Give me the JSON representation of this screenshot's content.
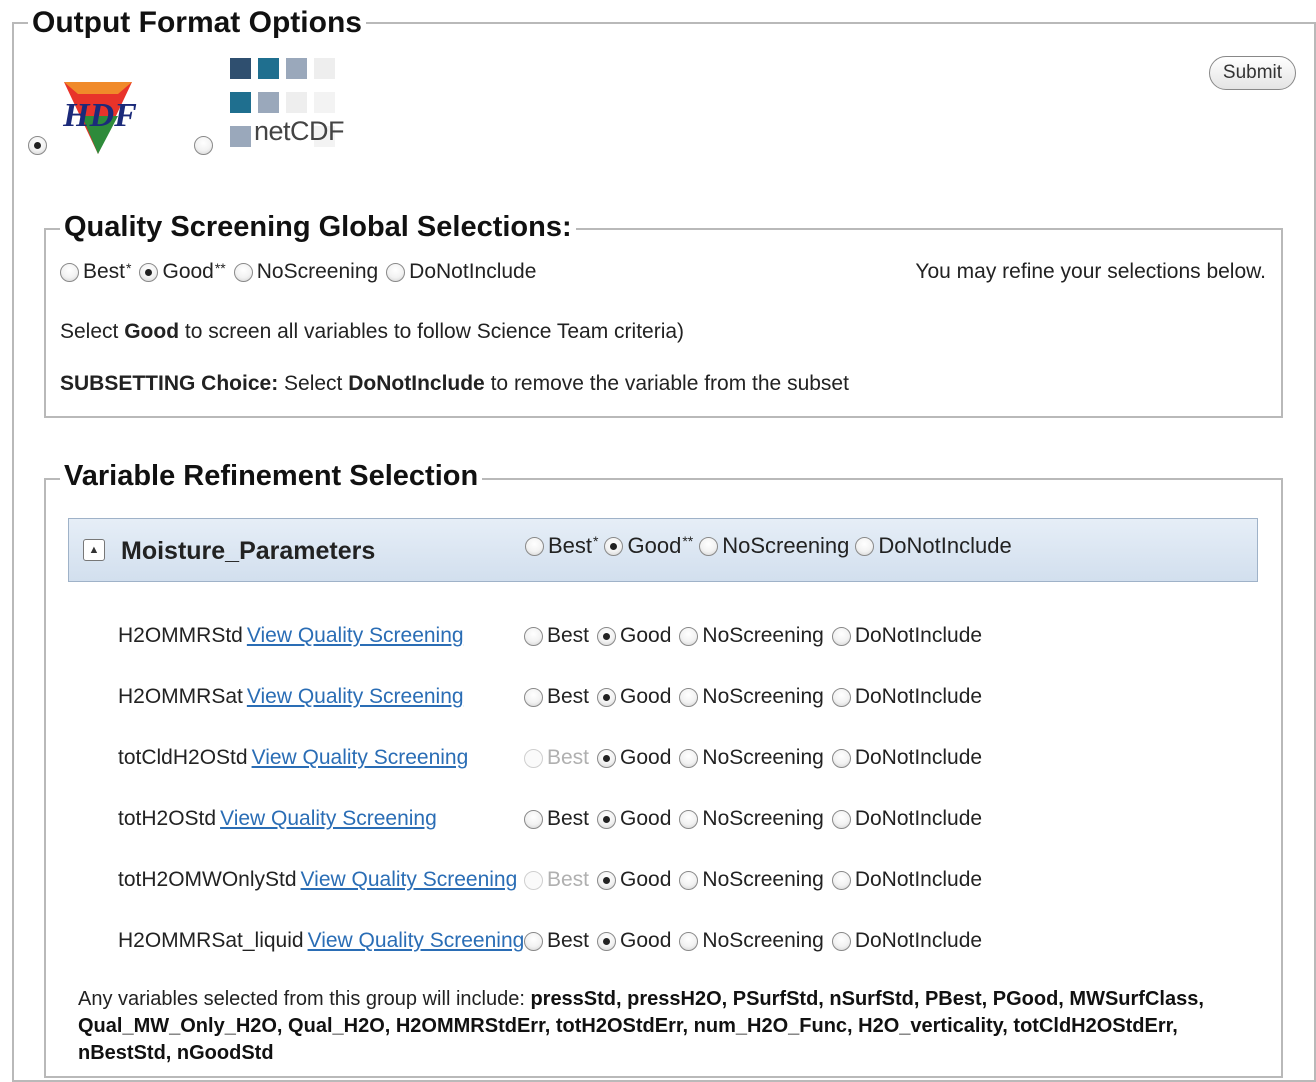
{
  "output_format": {
    "legend": "Output Format Options",
    "hdf_logo_text": "HDF",
    "netcdf_logo_text": "netCDF",
    "selected": "hdf",
    "submit_label": "Submit"
  },
  "quality_global": {
    "legend": "Quality Screening Global Selections:",
    "options": [
      {
        "label": "Best",
        "mark": "*",
        "checked": false
      },
      {
        "label": "Good",
        "mark": "**",
        "checked": true
      },
      {
        "label": "NoScreening",
        "mark": "",
        "checked": false
      },
      {
        "label": "DoNotInclude",
        "mark": "",
        "checked": false
      }
    ],
    "refine_text": "You may refine your selections below.",
    "line1_prefix": "Select",
    "line1_bold": "Good",
    "line1_suffix": "to screen all variables to follow Science Team criteria)",
    "line2_bold1": "SUBSETTING Choice:",
    "line2_text1": "Select",
    "line2_bold2": "DoNotInclude",
    "line2_text2": "to remove the variable from the subset"
  },
  "variable_refinement": {
    "legend": "Variable Refinement Selection",
    "group": {
      "collapse_symbol": "▲",
      "title": "Moisture_Parameters",
      "options": [
        {
          "label": "Best",
          "mark": "*",
          "checked": false
        },
        {
          "label": "Good",
          "mark": "**",
          "checked": true
        },
        {
          "label": "NoScreening",
          "mark": "",
          "checked": false
        },
        {
          "label": "DoNotInclude",
          "mark": "",
          "checked": false
        }
      ]
    },
    "link_text": "View Quality Screening",
    "option_labels": [
      "Best",
      "Good",
      "NoScreening",
      "DoNotInclude"
    ],
    "variables": [
      {
        "name": "H2OMMRStd",
        "best_disabled": false,
        "selected": "Good"
      },
      {
        "name": "H2OMMRSat",
        "best_disabled": false,
        "selected": "Good"
      },
      {
        "name": "totCldH2OStd",
        "best_disabled": true,
        "selected": "Good"
      },
      {
        "name": "totH2OStd",
        "best_disabled": false,
        "selected": "Good"
      },
      {
        "name": "totH2OMWOnlyStd",
        "best_disabled": true,
        "selected": "Good"
      },
      {
        "name": "H2OMMRSat_liquid",
        "best_disabled": false,
        "selected": "Good"
      }
    ],
    "includes_prefix": "Any variables selected from this group will include:",
    "includes_list": "pressStd, pressH2O, PSurfStd, nSurfStd, PBest, PGood, MWSurfClass, Qual_MW_Only_H2O, Qual_H2O, H2OMMRStdErr, totH2OStdErr, num_H2O_Func, H2O_verticality, totCldH2OStdErr, nBestStd, nGoodStd"
  },
  "colors": {
    "link": "#2a6db5",
    "group_header_bg": "#d9e4f1",
    "hdf_red": "#e8332a",
    "hdf_green": "#2e8b3a",
    "hdf_text": "#1b2a7a",
    "netcdf_dark": "#2f4f6f",
    "netcdf_mid": "#1f6f8f",
    "netcdf_light": "#9aa8bb"
  }
}
